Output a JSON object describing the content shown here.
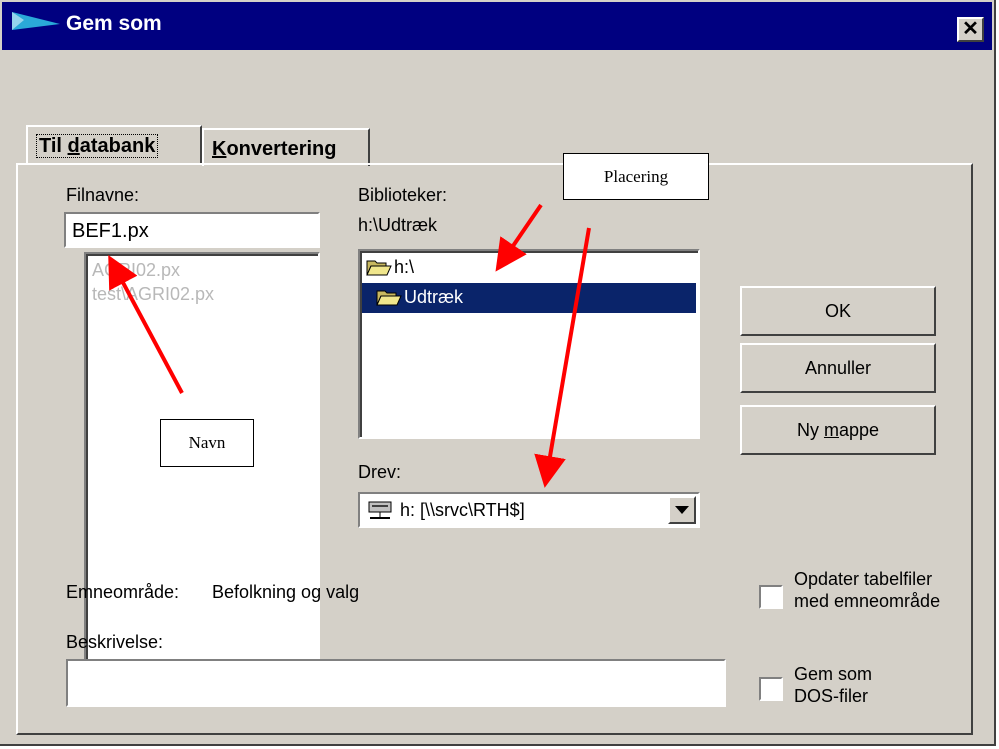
{
  "window": {
    "title": "Gem som",
    "close_glyph": "✕"
  },
  "tabs": [
    {
      "label_pre": "Til ",
      "label_u": "d",
      "label_post": "atabank",
      "active": true
    },
    {
      "label_pre": "",
      "label_u": "K",
      "label_post": "onvertering",
      "active": false
    }
  ],
  "filename": {
    "label": "Filnavne:",
    "value": "BEF1.px",
    "files": [
      "AGRI02.px",
      "test\\AGRI02.px"
    ]
  },
  "folders": {
    "label": "Biblioteker:",
    "current_path": "h:\\Udtræk",
    "items": [
      {
        "label": "h:\\",
        "icon": "open-folder-icon",
        "selected": false
      },
      {
        "label": "Udtræk",
        "icon": "open-folder-icon",
        "selected": true
      }
    ]
  },
  "drive": {
    "label": "Drev:",
    "value": "h: [\\\\srvc\\RTH$]",
    "icon": "network-drive-icon"
  },
  "buttons": {
    "ok": "OK",
    "cancel": "Annuller",
    "new_folder_pre": "Ny ",
    "new_folder_u": "m",
    "new_folder_post": "appe"
  },
  "subject": {
    "label": "Emneområde:",
    "value": "Befolkning og valg"
  },
  "description": {
    "label": "Beskrivelse:",
    "value": ""
  },
  "checkboxes": {
    "update_tables": {
      "line1": "Opdater tabelfiler",
      "line2": "med emneområde",
      "checked": false
    },
    "save_dos": {
      "line1": "Gem som",
      "line2": "DOS-filer",
      "checked": false
    }
  },
  "annotations": {
    "placering": "Placering",
    "navn": "Navn",
    "arrow_color": "#ff0000"
  },
  "colors": {
    "titlebar": "#000080",
    "face": "#d4d0c8",
    "selection": "#0a246a"
  }
}
